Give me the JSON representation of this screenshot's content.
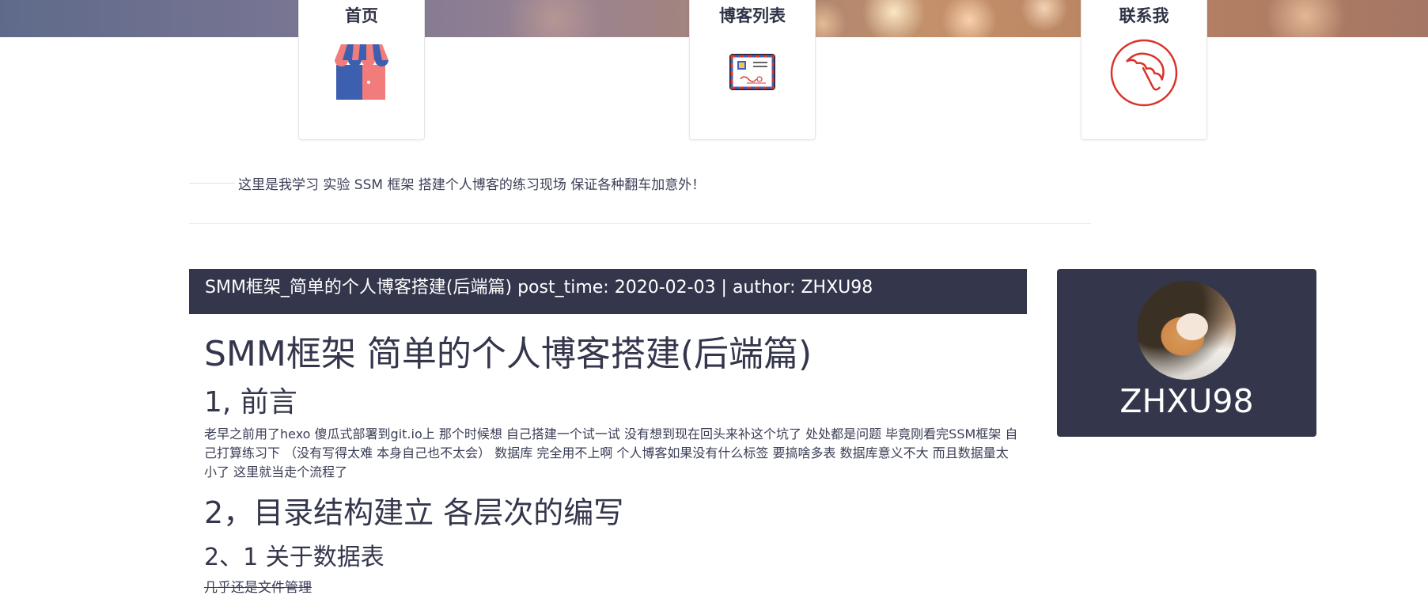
{
  "nav": {
    "items": [
      {
        "label": "首页",
        "icon": "shop-icon"
      },
      {
        "label": "博客列表",
        "icon": "postcard-icon"
      },
      {
        "label": "联系我",
        "icon": "umbrella-icon"
      }
    ]
  },
  "intro": {
    "text": "这里是我学习 实验 SSM 框架 搭建个人博客的练习现场 保证各种翻车加意外！"
  },
  "post": {
    "header": "SMM框架_简单的个人博客搭建(后端篇) post_time: 2020-02-03 | author: ZHXU98",
    "title": "SMM框架 简单的个人博客搭建(后端篇)",
    "section1_heading": "1, 前言",
    "section1_paragraph": "老早之前用了hexo 傻瓜式部署到git.io上 那个时候想 自己搭建一个试一试 没有想到现在回头来补这个坑了 处处都是问题 毕竟刚看完SSM框架 自己打算练习下 （没有写得太难 本身自己也不太会） 数据库 完全用不上啊 个人博客如果没有什么标签 要搞啥多表 数据库意义不大 而且数据量太小了 这里就当走个流程了",
    "section2_heading": "2，目录结构建立 各层次的编写",
    "section2_1_heading": "2、1 关于数据表",
    "section2_1_paragraph": "几乎还是文件管理"
  },
  "profile": {
    "name": "ZHXU98"
  },
  "colors": {
    "header_bg": "#34374c",
    "text": "#34374c",
    "shop_blue": "#3d5fb0",
    "shop_pink": "#f27c7c",
    "umbrella_red": "#d9342b"
  }
}
